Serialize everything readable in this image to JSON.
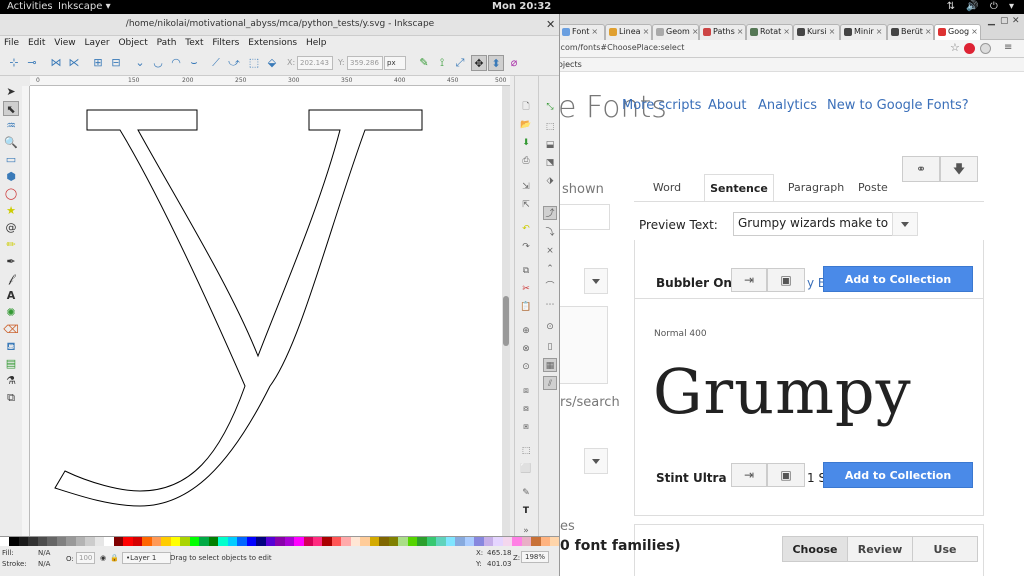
{
  "topbar": {
    "activities": "Activities",
    "app_menu": "Inkscape ▾",
    "clock": "Mon 20:32",
    "tray": "⇅ 🔊 ⏻ ▾"
  },
  "browser": {
    "tabs": [
      {
        "label": "Font",
        "color": "#6a9fe0"
      },
      {
        "label": "Linea",
        "color": "#e0a030"
      },
      {
        "label": "Geom",
        "color": "#aaaaaa"
      },
      {
        "label": "Paths",
        "color": "#cc4444"
      },
      {
        "label": "Rotat",
        "color": "#557755"
      },
      {
        "label": "Kursi",
        "color": "#444444"
      },
      {
        "label": "Minir",
        "color": "#444444"
      },
      {
        "label": "Berüt",
        "color": "#444444"
      },
      {
        "label": "Goog",
        "color": "#dd3333"
      }
    ],
    "url": ".com/fonts#ChoosePlace:select",
    "bookmark_text": "ojects",
    "logo_text": "e Fonts",
    "nav": [
      "More scripts",
      "About",
      "Analytics",
      "New to Google Fonts?"
    ],
    "left_shown": "shown",
    "left_search": "rs/search",
    "left_es": "es",
    "preview_tabs": [
      "Word",
      "Sentence",
      "Paragraph",
      "Poste"
    ],
    "preview_label": "Preview Text:",
    "preview_value": "Grumpy wizards make to",
    "fonts": [
      {
        "name": "Bubbler On",
        "peek": "y B",
        "add": "Add to Collection"
      },
      {
        "name": "Stint Ultra",
        "peek": "1 S",
        "add": "Add to Collection",
        "style": "Normal 400",
        "sample": "Grumpy"
      }
    ],
    "families_count": "0 font families)",
    "bottom": [
      "Choose",
      "Review",
      "Use"
    ]
  },
  "inkscape": {
    "title": "/home/nikolai/motivational_abyss/mca/python_tests/y.svg - Inkscape",
    "menu": [
      "File",
      "Edit",
      "View",
      "Layer",
      "Object",
      "Path",
      "Text",
      "Filters",
      "Extensions",
      "Help"
    ],
    "x_label": "X:",
    "x_value": "202.143",
    "y_label": "Y:",
    "y_value": "359.286",
    "unit": "px",
    "ruler_ticks": [
      "0",
      "150",
      "200",
      "250",
      "300",
      "350",
      "400",
      "450",
      "500"
    ],
    "status": {
      "fill_label": "Fill:",
      "fill_value": "N/A",
      "stroke_label": "Stroke:",
      "stroke_value": "N/A",
      "opacity_label": "O:",
      "opacity_value": "100",
      "layer": "•Layer 1",
      "message": "Drag to select objects to edit",
      "cursor_x": "465.18",
      "cursor_y": "401.03",
      "zoom_label": "Z:",
      "zoom_value": "198%"
    },
    "palette": [
      "#ffffff",
      "#000000",
      "#1a1a1a",
      "#333333",
      "#4d4d4d",
      "#666666",
      "#808080",
      "#999999",
      "#b3b3b3",
      "#cccccc",
      "#e6e6e6",
      "#ffffff",
      "#800000",
      "#ff0000",
      "#d40000",
      "#ff6600",
      "#ff9955",
      "#ffcc00",
      "#ffff00",
      "#aad400",
      "#00ff00",
      "#00aa44",
      "#008000",
      "#00ffcc",
      "#00ccff",
      "#0066ff",
      "#0000ff",
      "#000080",
      "#5500d4",
      "#8800aa",
      "#aa00d4",
      "#ff00ff",
      "#d40055",
      "#ff2a7f",
      "#aa0000",
      "#ff5555",
      "#ffaaaa",
      "#ffe6d5",
      "#ffcc99",
      "#d4aa00",
      "#806600",
      "#808000",
      "#aade87",
      "#55d400",
      "#2ca02c",
      "#37c871",
      "#5fd3bc",
      "#80e5ff",
      "#87aade",
      "#aaccff",
      "#8787de",
      "#c6afe9",
      "#e5d5ff",
      "#f4d7ee",
      "#ff80e5",
      "#e9afc6",
      "#c87137",
      "#ffb380",
      "#ffd5aa"
    ]
  }
}
